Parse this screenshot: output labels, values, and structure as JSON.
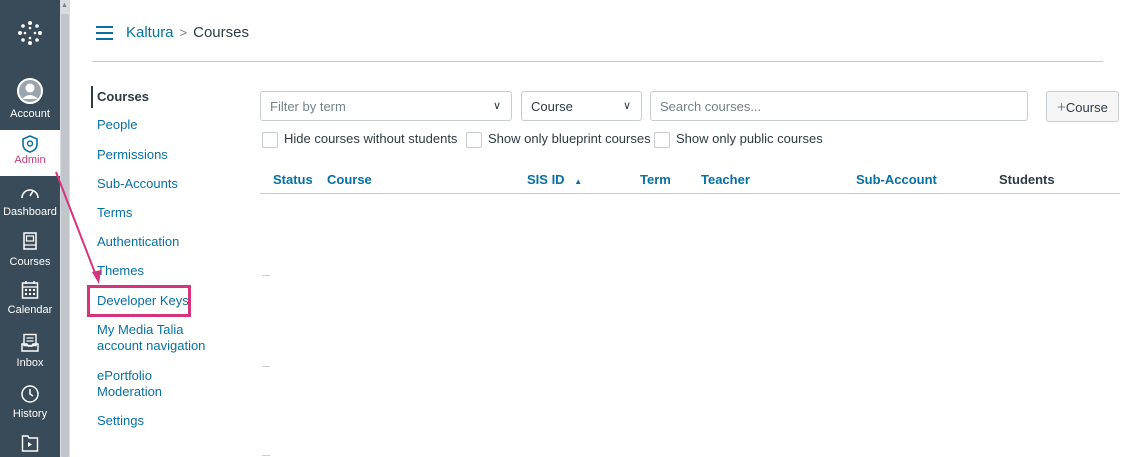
{
  "global_nav": {
    "items": [
      {
        "label": "Account",
        "icon": "avatar-icon"
      },
      {
        "label": "Admin",
        "icon": "shield-icon"
      },
      {
        "label": "Dashboard",
        "icon": "dashboard-icon"
      },
      {
        "label": "Courses",
        "icon": "book-icon"
      },
      {
        "label": "Calendar",
        "icon": "calendar-icon"
      },
      {
        "label": "Inbox",
        "icon": "inbox-icon"
      },
      {
        "label": "History",
        "icon": "clock-icon"
      },
      {
        "label": "",
        "icon": "commons-icon"
      }
    ],
    "active": "Admin"
  },
  "breadcrumb": {
    "root": "Kaltura",
    "separator": ">",
    "current": "Courses"
  },
  "left_nav": {
    "items": [
      "Courses",
      "People",
      "Permissions",
      "Sub-Accounts",
      "Terms",
      "Authentication",
      "Themes",
      "Developer Keys",
      "My Media Talia account navigation",
      "ePortfolio Moderation",
      "Settings"
    ],
    "active": "Courses",
    "highlighted": "Developer Keys"
  },
  "toolbar": {
    "term_filter_placeholder": "Filter by term",
    "search_type_value": "Course",
    "search_placeholder": "Search courses...",
    "add_course_label": "Course",
    "add_course_prefix": "+"
  },
  "filters": {
    "hide_no_students": "Hide courses without students",
    "blueprint_only": "Show only blueprint courses",
    "public_only": "Show only public courses"
  },
  "table": {
    "columns": [
      "Status",
      "Course",
      "SIS ID",
      "Term",
      "Teacher",
      "Sub-Account",
      "Students"
    ],
    "sort_indicator": "▲"
  },
  "colors": {
    "nav_bg": "#394b58",
    "link": "#0770a3",
    "highlight": "#d4337d",
    "admin_active": "#c23c7c"
  }
}
